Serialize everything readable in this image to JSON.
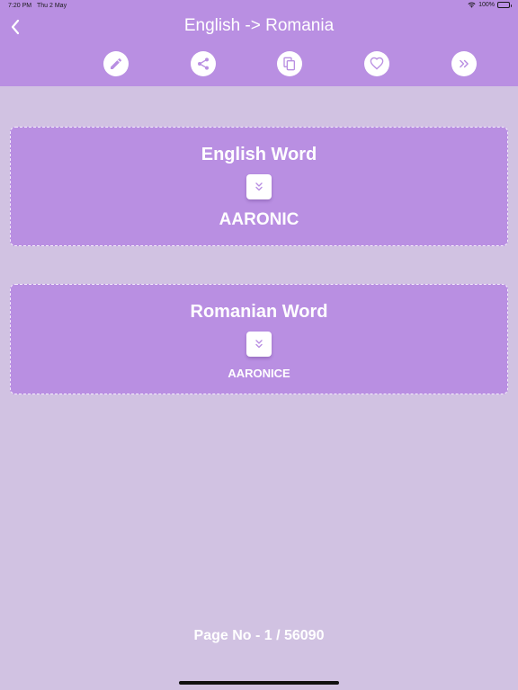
{
  "status_bar": {
    "time": "7:20 PM",
    "date": "Thu 2 May",
    "battery": "100%"
  },
  "header": {
    "title": "English -> Romania",
    "back_icon": "chevron-left-icon",
    "toolbar": [
      {
        "name": "edit",
        "icon": "pencil-icon"
      },
      {
        "name": "share",
        "icon": "share-icon"
      },
      {
        "name": "copy",
        "icon": "copy-icon"
      },
      {
        "name": "favorite",
        "icon": "heart-icon"
      },
      {
        "name": "next",
        "icon": "double-chevron-right-icon"
      }
    ]
  },
  "cards": {
    "english": {
      "label": "English Word",
      "word": "AARONIC",
      "icon": "double-chevron-down-icon"
    },
    "romanian": {
      "label": "Romanian Word",
      "word": "AARONICE",
      "icon": "double-chevron-down-icon"
    }
  },
  "footer": {
    "page_no": "Page No - 1 / 56090"
  },
  "colors": {
    "header": "#b98fe2",
    "background": "#d1c2e2",
    "card": "#b98fe2",
    "icon": "#b98fe2"
  }
}
